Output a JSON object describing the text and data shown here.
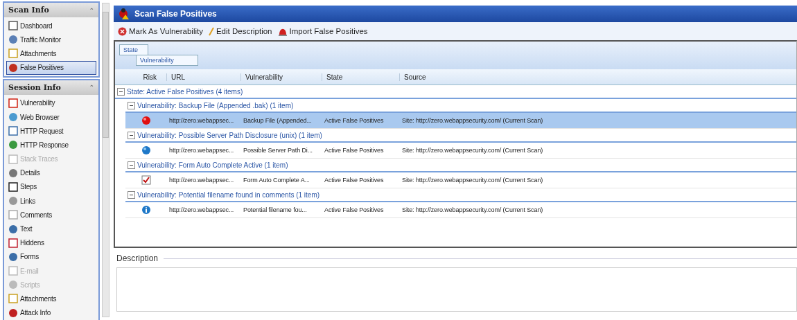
{
  "sidebar": {
    "sections": [
      {
        "title": "Scan Info",
        "toggle": "⌃",
        "items": [
          {
            "label": "Dashboard",
            "selected": false,
            "disabled": false
          },
          {
            "label": "Traffic Monitor",
            "selected": false,
            "disabled": false
          },
          {
            "label": "Attachments",
            "selected": false,
            "disabled": false
          },
          {
            "label": "False Positives",
            "selected": true,
            "disabled": false
          }
        ]
      },
      {
        "title": "Session Info",
        "toggle": "⌃",
        "items": [
          {
            "label": "Vulnerability",
            "selected": false,
            "disabled": false
          },
          {
            "label": "Web Browser",
            "selected": false,
            "disabled": false
          },
          {
            "label": "HTTP Request",
            "selected": false,
            "disabled": false
          },
          {
            "label": "HTTP Response",
            "selected": false,
            "disabled": false
          },
          {
            "label": "Stack Traces",
            "selected": false,
            "disabled": true
          },
          {
            "label": "Details",
            "selected": false,
            "disabled": false
          },
          {
            "label": "Steps",
            "selected": false,
            "disabled": false
          },
          {
            "label": "Links",
            "selected": false,
            "disabled": false
          },
          {
            "label": "Comments",
            "selected": false,
            "disabled": false
          },
          {
            "label": "Text",
            "selected": false,
            "disabled": false
          },
          {
            "label": "Hiddens",
            "selected": false,
            "disabled": false
          },
          {
            "label": "Forms",
            "selected": false,
            "disabled": false
          },
          {
            "label": "E-mail",
            "selected": false,
            "disabled": true
          },
          {
            "label": "Scripts",
            "selected": false,
            "disabled": true
          },
          {
            "label": "Attachments",
            "selected": false,
            "disabled": false
          },
          {
            "label": "Attack Info",
            "selected": false,
            "disabled": false
          }
        ]
      }
    ]
  },
  "window": {
    "title": "Scan False Positives"
  },
  "toolbar": [
    "Mark As Vulnerability",
    "Edit Description",
    "Import False Positives"
  ],
  "group_by": [
    "State",
    "Vulnerability"
  ],
  "table": {
    "columns": [
      "Risk",
      "URL",
      "Vulnerability",
      "State",
      "Source"
    ],
    "group": {
      "label": "State: Active False Positives (4 items)",
      "expanded": true,
      "children": [
        {
          "label": "Vulnerability: Backup File (Appended .bak) (1 item)",
          "expanded": true,
          "rows": [
            {
              "kind": "high",
              "selected": true,
              "cells": [
                "http://zero.webappsec...",
                "Backup File (Appended...",
                "Active False Positives",
                "Site: http://zero.webappsecurity.com/ (Current Scan)"
              ]
            }
          ]
        },
        {
          "label": "Vulnerability: Possible Server Path Disclosure (unix) (1 item)",
          "expanded": true,
          "rows": [
            {
              "kind": "globe",
              "selected": false,
              "cells": [
                "http://zero.webappsec...",
                "Possible Server Path Di...",
                "Active False Positives",
                "Site: http://zero.webappsecurity.com/ (Current Scan)"
              ]
            }
          ]
        },
        {
          "label": "Vulnerability: Form Auto Complete Active (1 item)",
          "expanded": true,
          "rows": [
            {
              "kind": "check",
              "selected": false,
              "cells": [
                "http://zero.webappsec...",
                "Form Auto Complete A...",
                "Active False Positives",
                "Site: http://zero.webappsecurity.com/ (Current Scan)"
              ]
            }
          ]
        },
        {
          "label": "Vulnerability: Potential filename found in comments (1 item)",
          "expanded": true,
          "rows": [
            {
              "kind": "info",
              "selected": false,
              "cells": [
                "http://zero.webappsec...",
                "Potential filename fou...",
                "Active False Positives",
                "Site: http://zero.webappsecurity.com/ (Current Scan)"
              ]
            }
          ]
        }
      ]
    }
  },
  "description": {
    "label": "Description"
  }
}
